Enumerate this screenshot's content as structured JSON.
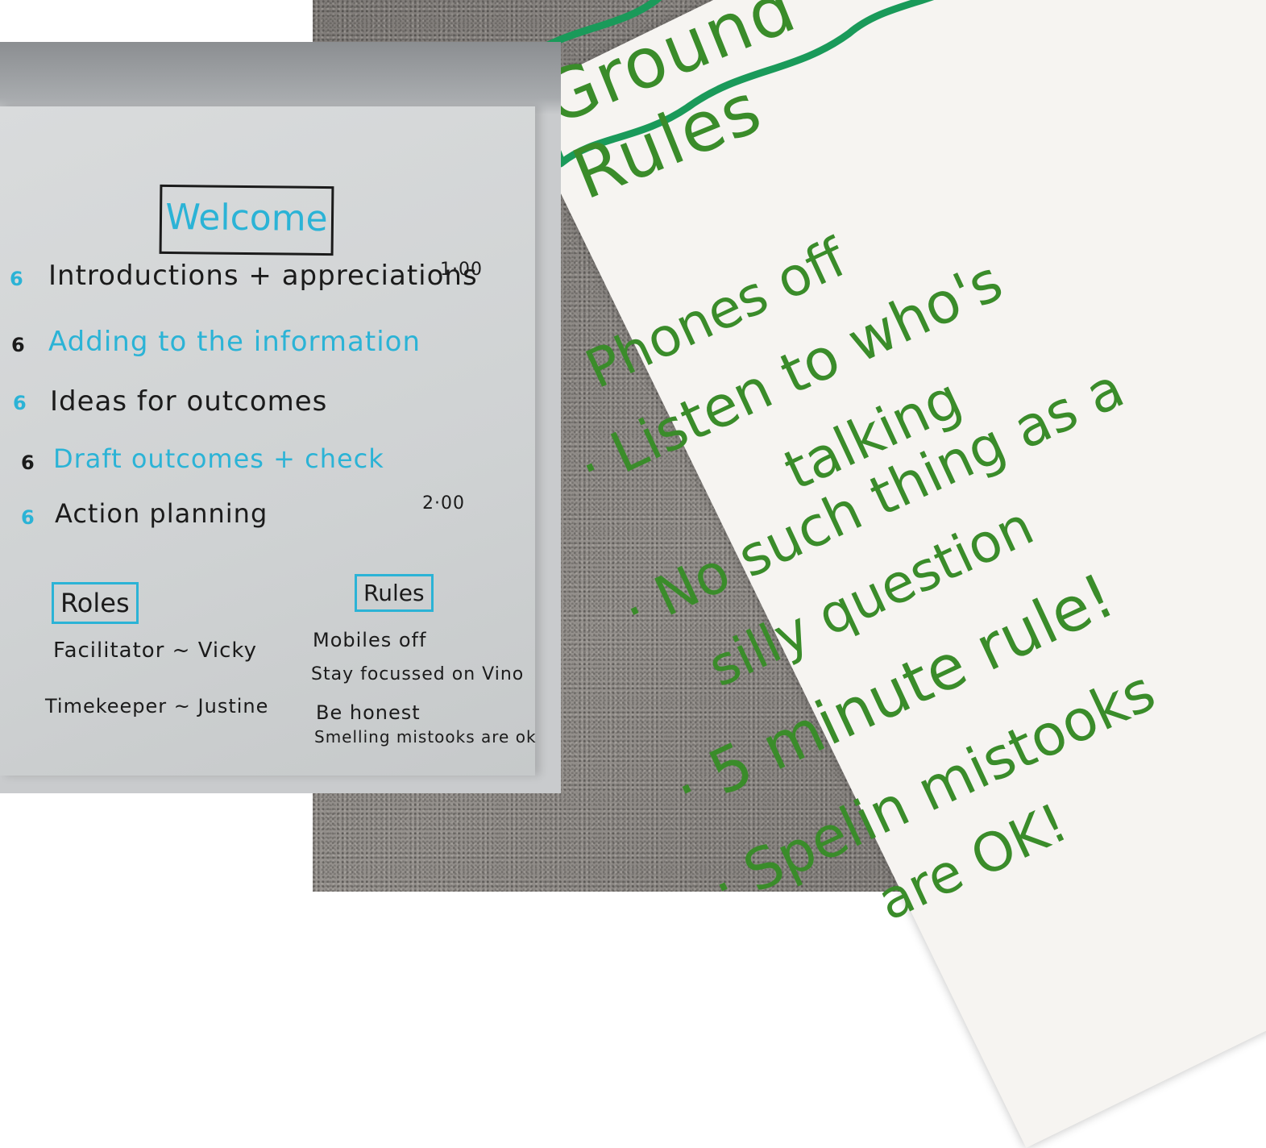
{
  "left_chart": {
    "title": "Welcome",
    "agenda": [
      {
        "bullet": "6",
        "text": "Introductions + appreciations",
        "time": "1·00",
        "ink": "dark"
      },
      {
        "bullet": "6",
        "text": "Adding to the information",
        "time": "",
        "ink": "blue"
      },
      {
        "bullet": "6",
        "text": "Ideas for outcomes",
        "time": "",
        "ink": "dark"
      },
      {
        "bullet": "6",
        "text": "Draft outcomes + check",
        "time": "",
        "ink": "blue"
      },
      {
        "bullet": "6",
        "text": "Action planning",
        "time": "2·00",
        "ink": "dark"
      }
    ],
    "roles_heading": "Roles",
    "roles": [
      "Facilitator ~ Vicky",
      "Timekeeper ~ Justine"
    ],
    "rules_heading": "Rules",
    "rules": [
      "Mobiles off",
      "Stay focussed on Vino",
      "Be honest",
      "Smelling mistooks are ok"
    ]
  },
  "right_chart": {
    "title": "Ground Rules",
    "items": [
      "Phones off",
      "· Listen to who's",
      "talking",
      "· No such thing as a",
      "silly question",
      "· 5 minute rule!",
      "· Spelin mistooks",
      "are OK!"
    ]
  },
  "colors": {
    "blue_ink": "#2bb3d6",
    "dark_ink": "#1b1b1b",
    "green_ink": "#3a8c2a",
    "banner_ink": "#1a9a5a"
  }
}
